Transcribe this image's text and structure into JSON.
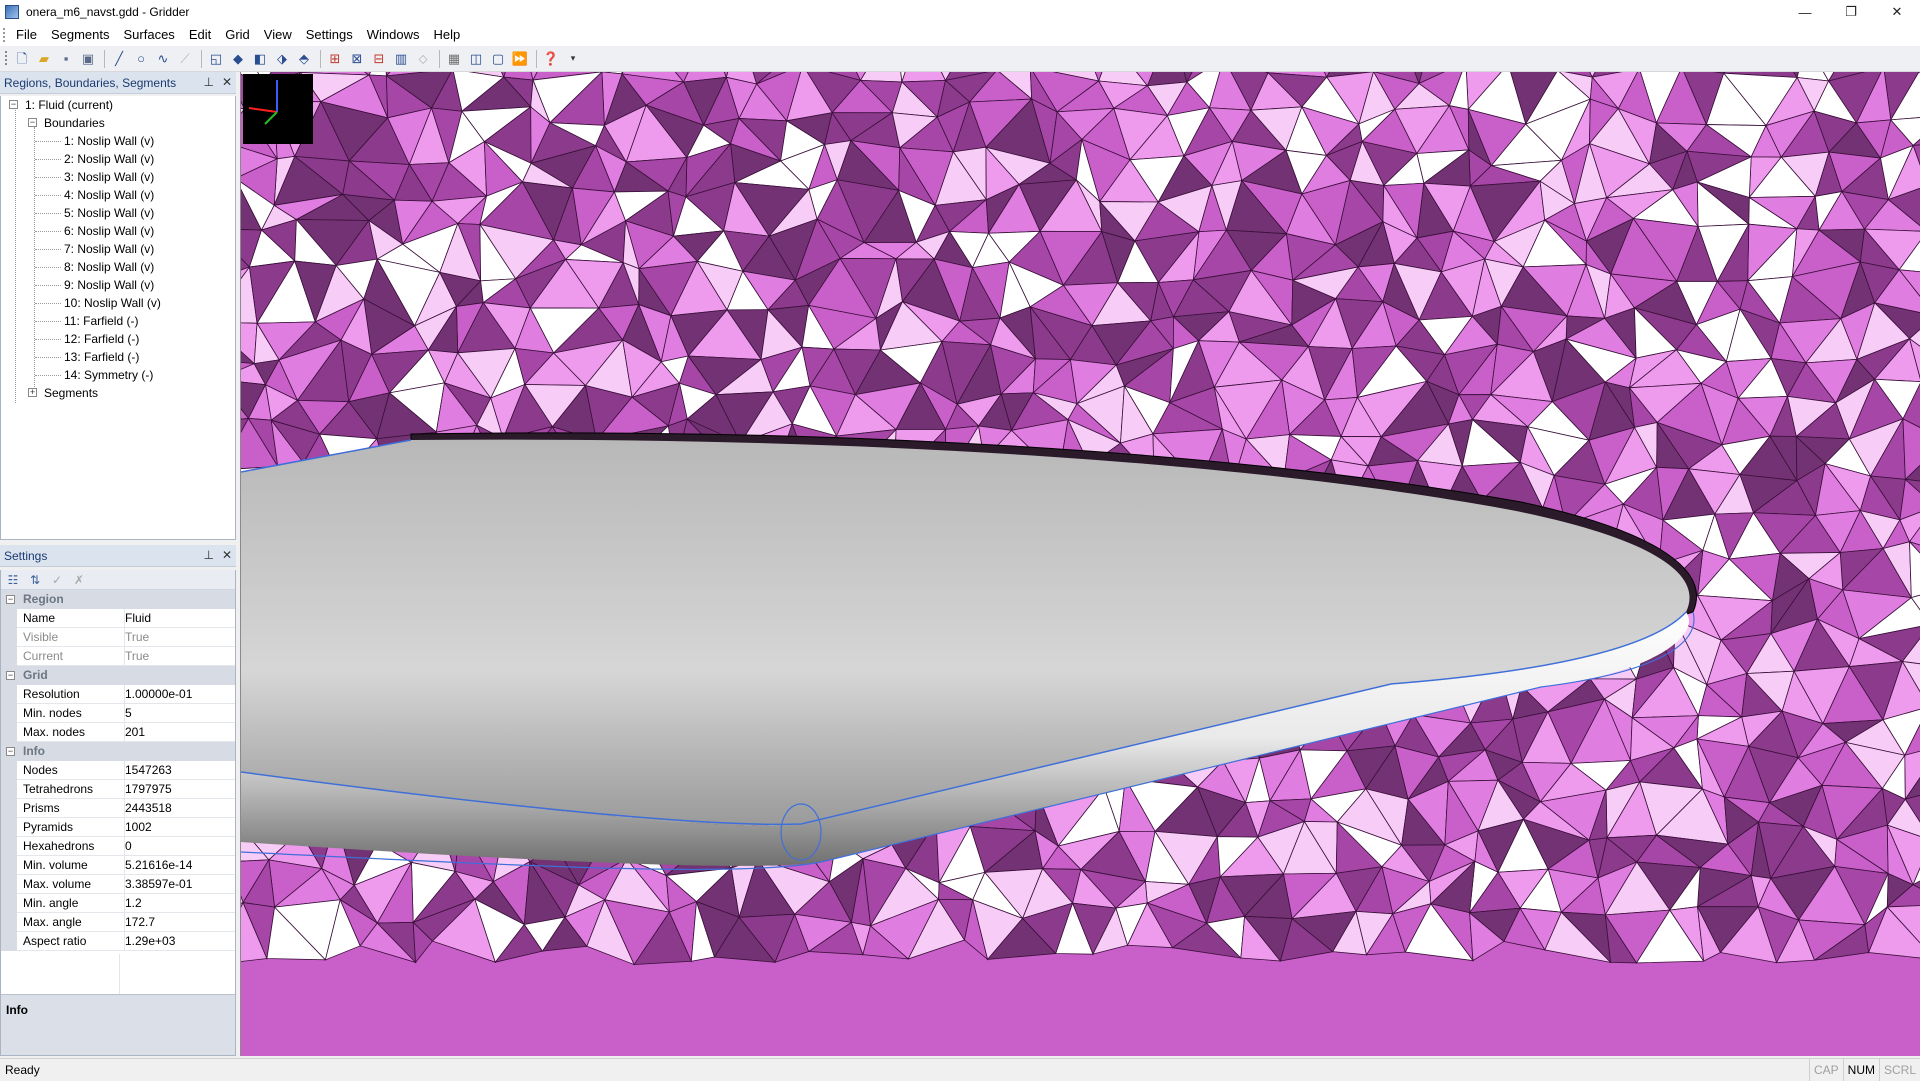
{
  "window": {
    "title": "onera_m6_navst.gdd - Gridder",
    "minimize": "—",
    "maximize": "❐",
    "close": "✕"
  },
  "menu": [
    "File",
    "Segments",
    "Surfaces",
    "Edit",
    "Grid",
    "View",
    "Settings",
    "Windows",
    "Help"
  ],
  "toolbar": {
    "icons": [
      "new-file-icon",
      "open-file-icon",
      "save-icon",
      "save-as-icon",
      "line-icon",
      "circle-icon",
      "curve-icon",
      "disabled-curve-icon",
      "region-icon",
      "diamond-icon",
      "cube-icon",
      "transform-icon",
      "eraser-icon",
      "grid-split-icon",
      "grid-refine-icon",
      "grid-fit-icon",
      "grid-columns-icon",
      "disabled-tool-icon",
      "mesh-icon",
      "view-3d-icon",
      "view-box-icon",
      "play-forward-icon",
      "help-icon"
    ]
  },
  "tree_panel": {
    "title": "Regions, Boundaries, Segments",
    "region": "1: Fluid (current)",
    "boundaries_label": "Boundaries",
    "boundaries": [
      "1: Noslip Wall (v)",
      "2: Noslip Wall (v)",
      "3: Noslip Wall (v)",
      "4: Noslip Wall (v)",
      "5: Noslip Wall (v)",
      "6: Noslip Wall (v)",
      "7: Noslip Wall (v)",
      "8: Noslip Wall (v)",
      "9: Noslip Wall (v)",
      "10: Noslip Wall (v)",
      "11: Farfield (-)",
      "12: Farfield (-)",
      "13: Farfield (-)",
      "14: Symmetry (-)"
    ],
    "segments_label": "Segments"
  },
  "settings_panel": {
    "title": "Settings",
    "categories": [
      {
        "name": "Region",
        "rows": [
          {
            "name": "Name",
            "value": "Fluid",
            "grey": false
          },
          {
            "name": "Visible",
            "value": "True",
            "grey": true
          },
          {
            "name": "Current",
            "value": "True",
            "grey": true
          }
        ]
      },
      {
        "name": "Grid",
        "rows": [
          {
            "name": "Resolution",
            "value": "1.00000e-01",
            "grey": false
          },
          {
            "name": "Min. nodes",
            "value": "5",
            "grey": false
          },
          {
            "name": "Max. nodes",
            "value": "201",
            "grey": false
          }
        ]
      },
      {
        "name": "Info",
        "rows": [
          {
            "name": "Nodes",
            "value": "1547263",
            "grey": false
          },
          {
            "name": "Tetrahedrons",
            "value": "1797975",
            "grey": false
          },
          {
            "name": "Prisms",
            "value": "2443518",
            "grey": false
          },
          {
            "name": "Pyramids",
            "value": "1002",
            "grey": false
          },
          {
            "name": "Hexahedrons",
            "value": "0",
            "grey": false
          },
          {
            "name": "Min. volume",
            "value": "5.21616e-14",
            "grey": false
          },
          {
            "name": "Max. volume",
            "value": "3.38597e-01",
            "grey": false
          },
          {
            "name": "Min. angle",
            "value": "1.2",
            "grey": false
          },
          {
            "name": "Max. angle",
            "value": "172.7",
            "grey": false
          },
          {
            "name": "Aspect ratio",
            "value": "1.29e+03",
            "grey": false
          }
        ]
      }
    ],
    "info_box_label": "Info"
  },
  "status": {
    "text": "Ready",
    "indicators": [
      {
        "label": "CAP",
        "on": false
      },
      {
        "label": "NUM",
        "on": true
      },
      {
        "label": "SCRL",
        "on": false
      }
    ]
  },
  "colors": {
    "mesh_base": "#c95fc9",
    "mesh_shades": [
      "#ffffff",
      "#f7ccf7",
      "#ee9bee",
      "#e07de0",
      "#c95fc9",
      "#a646a6",
      "#8c3a8c",
      "#733273"
    ],
    "wing_surface": "#c8c8c8",
    "edge_lines": "#3f6fd9"
  }
}
